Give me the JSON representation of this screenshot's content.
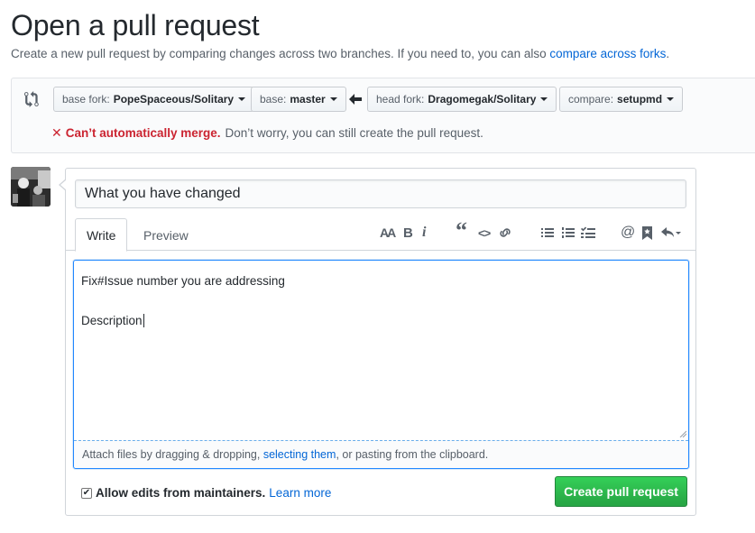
{
  "header": {
    "title": "Open a pull request",
    "subtitle_prefix": "Create a new pull request by comparing changes across two branches. If you need to, you can also ",
    "subtitle_link": "compare across forks",
    "subtitle_suffix": "."
  },
  "range": {
    "base_fork_label": "base fork:",
    "base_fork_value": "PopeSpaceous/Solitary",
    "base_label": "base:",
    "base_value": "master",
    "head_fork_label": "head fork:",
    "head_fork_value": "Dragomegak/Solitary",
    "compare_label": "compare:",
    "compare_value": "setupmd",
    "merge_status_bad": "Can’t automatically merge.",
    "merge_status_note": "Don’t worry, you can still create the pull request."
  },
  "form": {
    "title_value": "What you have changed",
    "tabs": [
      {
        "label": "Write"
      },
      {
        "label": "Preview"
      }
    ],
    "body_line1": "Fix#Issue number you are addressing",
    "body_line2": "",
    "body_line3": "Description",
    "drop_prefix": "Attach files by dragging & dropping, ",
    "drop_link": "selecting them",
    "drop_suffix": ", or pasting from the clipboard.",
    "maintainers_label": "Allow edits from maintainers.",
    "learn_more": "Learn more",
    "create_button": "Create pull request"
  },
  "toolbar": {
    "icons": [
      "header-icon",
      "bold-icon",
      "italic-icon",
      "quote-icon",
      "code-icon",
      "link-icon",
      "bullet-list-icon",
      "numbered-list-icon",
      "task-list-icon",
      "mention-icon",
      "reference-icon",
      "reply-icon"
    ],
    "header_glyph": "AA",
    "bold_glyph": "B",
    "italic_glyph": "i",
    "quote_glyph": "“",
    "code_glyph": "<>",
    "mention_glyph": "@"
  },
  "colors": {
    "accent": "#0366d6",
    "error": "#cb2431",
    "success": "#28a745",
    "focus": "#2188ff"
  }
}
